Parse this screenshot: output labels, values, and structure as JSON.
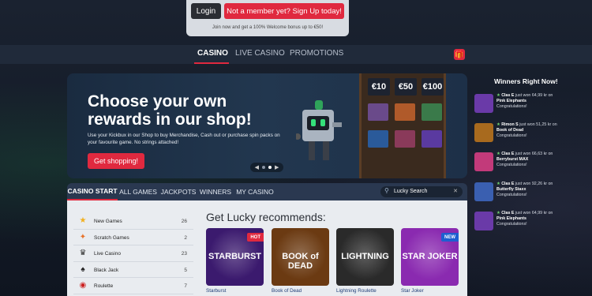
{
  "header": {
    "login_label": "Login",
    "signup_label": "Not a member yet? Sign Up today!",
    "bonus_text": "Join now and get a 100% Welcome bonus up to €50!"
  },
  "nav": {
    "items": [
      "CASINO",
      "LIVE CASINO",
      "PROMOTIONS"
    ],
    "gift_icon": "gift-icon"
  },
  "hero": {
    "title": "Choose your own rewards in our shop!",
    "text": "Use your Kickbux in our Shop to buy Merchandise, Cash out or purchase spin packs on your favourite game. No strings attached!",
    "button": "Get shopping!",
    "shelf_values": [
      "€10",
      "€50",
      "€100"
    ]
  },
  "winners": {
    "title": "Winners Right Now!",
    "items": [
      {
        "name": "Clas E",
        "amount": "64,99 kr",
        "game": "Pink Elephants",
        "congrats": "Congratulations!",
        "color": "#6a3aa8"
      },
      {
        "name": "Rimon S",
        "amount": "51,25 kr",
        "game": "Book of Dead",
        "congrats": "Congratulations!",
        "color": "#a86a1e"
      },
      {
        "name": "Clas E",
        "amount": "66,63 kr",
        "game": "Berryburst MAX",
        "congrats": "Congratulations!",
        "color": "#c23a7a"
      },
      {
        "name": "Clas E",
        "amount": "92,26 kr",
        "game": "Butterfly Staxx",
        "congrats": "Congratulations!",
        "color": "#3a5fb0"
      },
      {
        "name": "Clas E",
        "amount": "64,99 kr",
        "game": "Pink Elephants",
        "congrats": "Congratulations!",
        "color": "#6a3aa8"
      }
    ],
    "just_won": "just won",
    "on": "on"
  },
  "tabs": [
    "CASINO START",
    "ALL GAMES",
    "JACKPOTS",
    "WINNERS",
    "MY CASINO"
  ],
  "search": {
    "placeholder": "Lucky Search"
  },
  "categories": [
    {
      "label": "New Games",
      "count": "26",
      "icon": "star-icon",
      "glyph": "★",
      "color": "#f2b01e"
    },
    {
      "label": "Scratch Games",
      "count": "2",
      "icon": "scratch-icon",
      "glyph": "✦",
      "color": "#e8732a"
    },
    {
      "label": "Live Casino",
      "count": "23",
      "icon": "dealer-icon",
      "glyph": "♛",
      "color": "#333"
    },
    {
      "label": "Black Jack",
      "count": "5",
      "icon": "cards-icon",
      "glyph": "♠",
      "color": "#222"
    },
    {
      "label": "Roulette",
      "count": "7",
      "icon": "roulette-icon",
      "glyph": "◉",
      "color": "#c22"
    }
  ],
  "recommend": {
    "title": "Get Lucky recommends:",
    "games": [
      {
        "name": "Starburst",
        "art": "STARBURST",
        "badge": "HOT",
        "badge_color": "#e0293f",
        "bg": "#3b1a6e"
      },
      {
        "name": "Book of Dead",
        "art": "BOOK of DEAD",
        "badge": "",
        "badge_color": "",
        "bg": "#6b3a12"
      },
      {
        "name": "Lightning Roulette",
        "art": "LIGHTNING",
        "badge": "",
        "badge_color": "",
        "bg": "#2a2a2a"
      },
      {
        "name": "Star Joker",
        "art": "STAR JOKER",
        "badge": "NEW",
        "badge_color": "#1e5fd0",
        "bg": "#8a2ab0"
      }
    ]
  }
}
